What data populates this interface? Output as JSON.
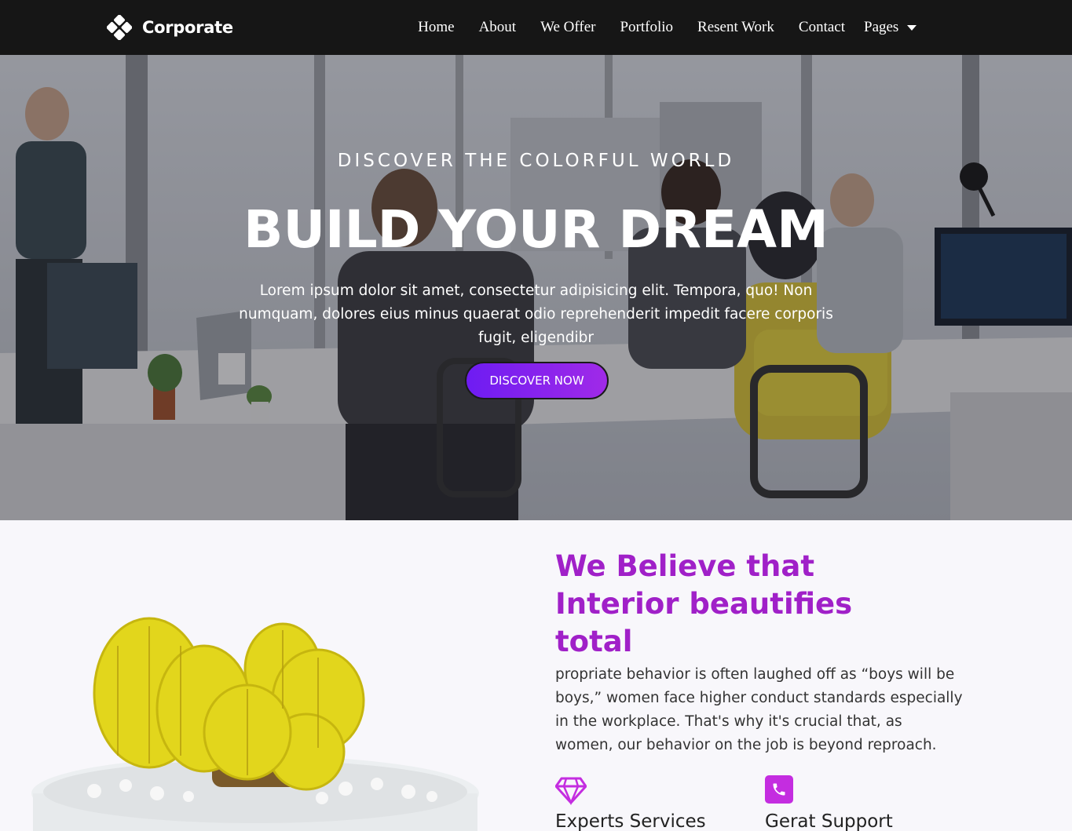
{
  "brand": {
    "name": "Corporate",
    "icon": "diamond-cluster-logo-icon"
  },
  "nav": {
    "items": [
      "Home",
      "About",
      "We Offer",
      "Portfolio",
      "Resent Work",
      "Contact"
    ],
    "dropdown_label": "Pages"
  },
  "hero": {
    "subtitle": "DISCOVER THE COLORFUL WORLD",
    "title": "BUILD YOUR DREAM",
    "text": "Lorem ipsum dolor sit amet, consectetur adipisicing elit. Tempora, quo! Non numquam, dolores eius minus quaerat odio reprehenderit impedit facere corporis fugit, eligendibr",
    "button_label": "DISCOVER NOW"
  },
  "about": {
    "title": "We Believe that Interior beautifies total",
    "text": "propriate behavior is often laughed off as “boys will be boys,” women face higher conduct standards especially in the workplace. That's why it's crucial that, as women, our behavior on the job is beyond reproach.",
    "features": [
      {
        "icon": "diamond-icon",
        "title": "Experts Services"
      },
      {
        "icon": "phone-icon",
        "title": "Gerat Support"
      }
    ]
  },
  "colors": {
    "accent": "#a020c8",
    "button_start": "#6e1cf2",
    "button_end": "#a02ae8",
    "navbar": "#0c0c0c"
  }
}
